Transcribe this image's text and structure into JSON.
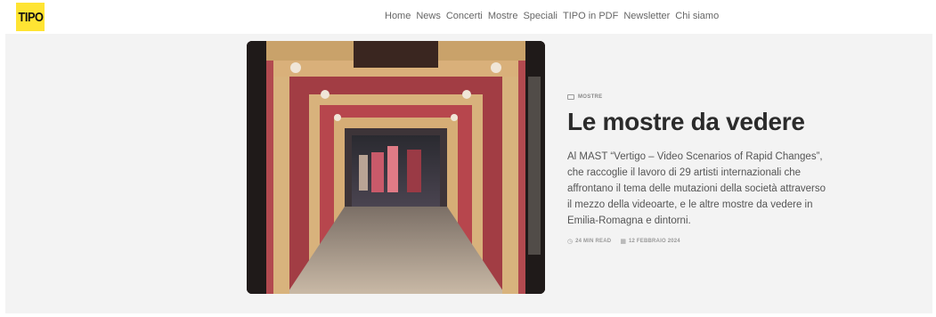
{
  "header": {
    "logo_text": "TIPO",
    "logo_color": "#ffe433",
    "nav": [
      "Home",
      "News",
      "Concerti",
      "Mostre",
      "Speciali",
      "TIPO in PDF",
      "Newsletter",
      "Chi siamo"
    ]
  },
  "article": {
    "category": "MOSTRE",
    "title": "Le mostre da vedere",
    "excerpt": "Al MAST “Vertigo – Video Scenarios of Rapid Changes”, che raccoglie il lavoro di 29 artisti internazionali che affrontano il tema delle mutazioni della società attraverso il mezzo della videoarte, e le altre mostre da vedere in Emilia-Romagna e dintorni.",
    "read_time": "24 MIN READ",
    "date": "12 FEBBRAIO 2024",
    "icons": {
      "category": "folder-icon",
      "read_time": "clock-icon",
      "date": "calendar-icon"
    }
  }
}
